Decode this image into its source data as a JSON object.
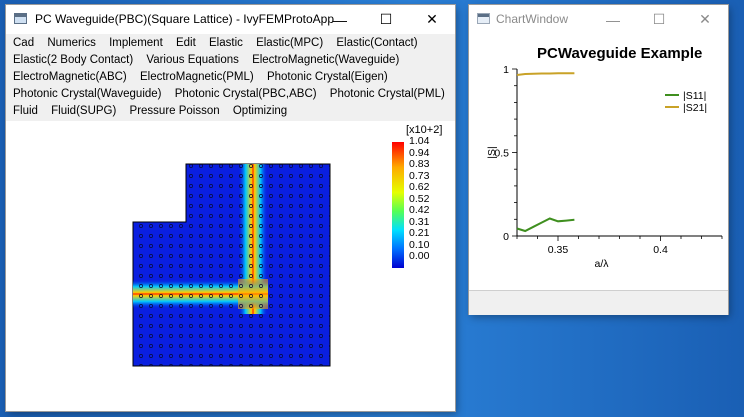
{
  "main_window": {
    "title": "PC Waveguide(PBC)(Square Lattice) - IvyFEMProtoApp",
    "controls": {
      "minimize": "—",
      "maximize": "☐",
      "close": "✕"
    },
    "menu_rows": [
      [
        "Cad",
        "Numerics",
        "Implement",
        "Edit",
        "Elastic",
        "Elastic(MPC)",
        "Elastic(Contact)"
      ],
      [
        "Elastic(2 Body Contact)",
        "Various Equations",
        "ElectroMagnetic(Waveguide)"
      ],
      [
        "ElectroMagnetic(ABC)",
        "ElectroMagnetic(PML)",
        "Photonic Crystal(Eigen)"
      ],
      [
        "Photonic Crystal(Waveguide)",
        "Photonic Crystal(PBC,ABC)",
        "Photonic Crystal(PML)"
      ],
      [
        "Fluid",
        "Fluid(SUPG)",
        "Pressure Poisson",
        "Optimizing"
      ]
    ],
    "colorbar": {
      "exponent": "[x10+2]",
      "ticks": [
        "1.04",
        "0.94",
        "0.83",
        "0.73",
        "0.62",
        "0.52",
        "0.42",
        "0.31",
        "0.21",
        "0.10",
        "0.00"
      ]
    }
  },
  "chart_window": {
    "title": "ChartWindow",
    "controls": {
      "minimize": "—",
      "maximize": "☐",
      "close": "✕"
    }
  },
  "chart_data": {
    "type": "line",
    "title": "PCWaveguide Example",
    "xlabel": "a/λ",
    "ylabel": "|S|",
    "xlim": [
      0.33,
      0.43
    ],
    "ylim": [
      0,
      1
    ],
    "xticks": [
      "0.35",
      "0.4"
    ],
    "yticks": [
      "1",
      "0.5",
      "0"
    ],
    "legend_position": "top-right",
    "series": [
      {
        "name": "|S11|",
        "color": "#3f8f1f",
        "x": [
          0.33,
          0.334,
          0.338,
          0.342,
          0.346,
          0.35,
          0.354,
          0.358
        ],
        "y": [
          0.045,
          0.03,
          0.055,
          0.08,
          0.105,
          0.088,
          0.092,
          0.097
        ]
      },
      {
        "name": "|S21|",
        "color": "#c9a227",
        "x": [
          0.33,
          0.334,
          0.338,
          0.342,
          0.346,
          0.35,
          0.354,
          0.358
        ],
        "y": [
          0.964,
          0.97,
          0.972,
          0.973,
          0.973,
          0.974,
          0.974,
          0.975
        ]
      }
    ]
  }
}
